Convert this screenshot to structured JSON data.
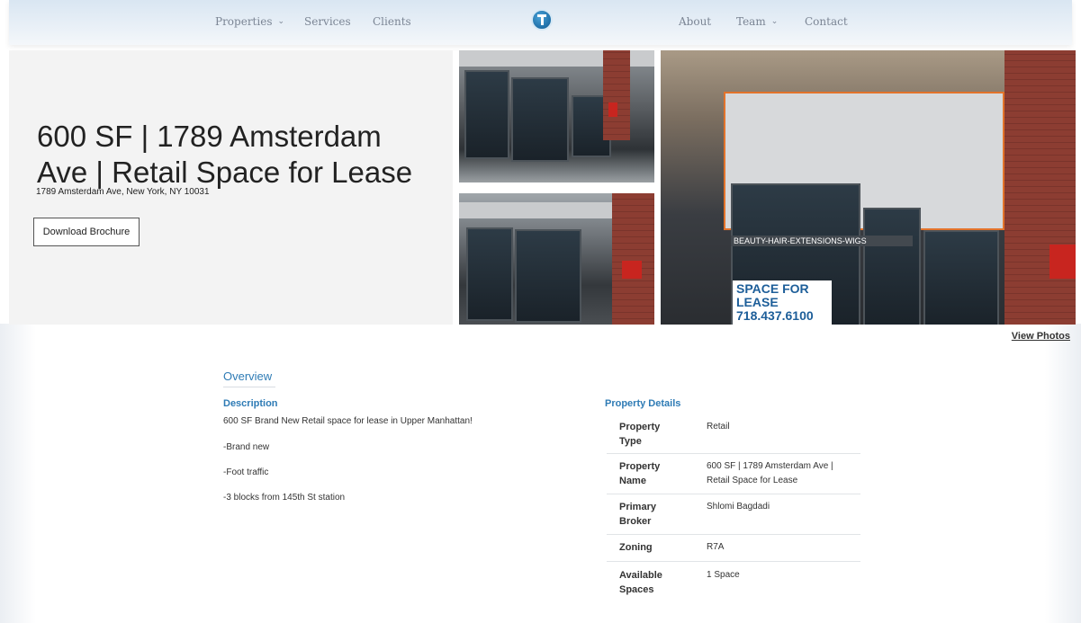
{
  "nav": {
    "items_left": [
      {
        "label": "Properties",
        "dropdown": true
      },
      {
        "label": "Services",
        "dropdown": false
      },
      {
        "label": "Clients",
        "dropdown": false
      }
    ],
    "items_right": [
      {
        "label": "About",
        "dropdown": false
      },
      {
        "label": "Team",
        "dropdown": true
      },
      {
        "label": "Contact",
        "dropdown": false
      }
    ],
    "logo_icon": "map-pin-t-logo-icon",
    "chevron_glyph": "⌄"
  },
  "hero": {
    "title": "600 SF | 1789 Amsterdam Ave | Retail Space for Lease",
    "address": "1789 Amsterdam Ave, New York, NY 10031",
    "brochure_button": "Download Brochure",
    "photos": [
      {
        "name": "storefront-photo-1"
      },
      {
        "name": "storefront-photo-2"
      },
      {
        "name": "storefront-photo-main",
        "sign_text": "BEAUTY-HAIR-EXTENSIONS-WIGS",
        "lease_sign": "SPACE FOR LEASE 718.437.6100"
      }
    ],
    "view_photos": "View Photos"
  },
  "overview": {
    "title": "Overview",
    "description": {
      "heading": "Description",
      "lines": [
        "600 SF Brand New Retail space for lease in Upper Manhattan!",
        "-Brand new",
        "-Foot traffic",
        "-3 blocks from 145th St station"
      ]
    },
    "property_details": {
      "heading": "Property Details",
      "rows": [
        {
          "label": "Property Type",
          "value": "Retail"
        },
        {
          "label": "Property Name",
          "value": "600 SF | 1789 Amsterdam Ave | Retail Space for Lease"
        },
        {
          "label": "Primary Broker",
          "value": "Shlomi Bagdadi"
        },
        {
          "label": "Zoning",
          "value": "R7A"
        },
        {
          "label": "Available Spaces",
          "value": "1 Space"
        }
      ]
    }
  },
  "colors": {
    "accent": "#2e7bb5",
    "nav_text": "#7b8594",
    "hero_bg": "#f3f3f3"
  }
}
